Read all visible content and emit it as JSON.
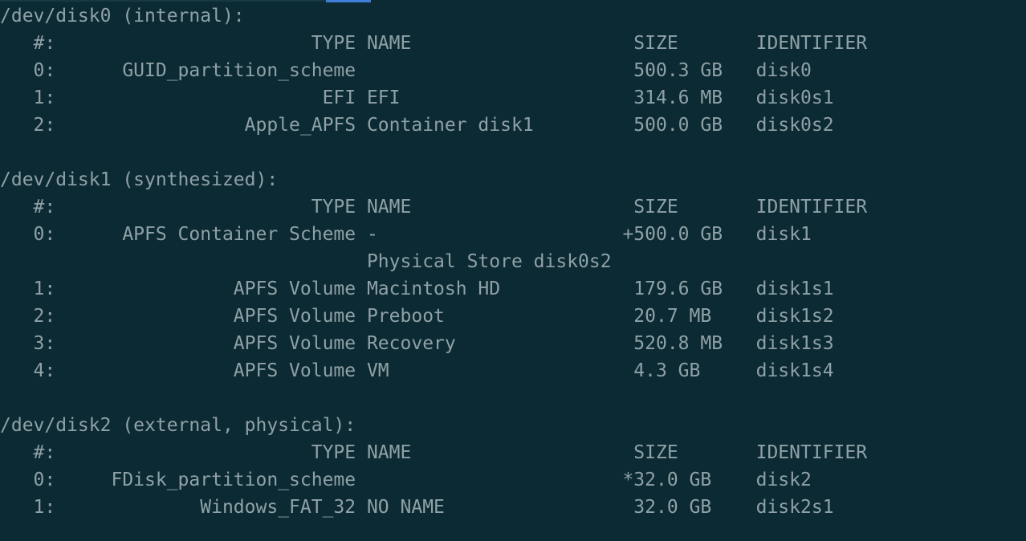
{
  "terminal": {
    "lines": [
      "/dev/disk0 (internal):",
      "   #:                       TYPE NAME                    SIZE       IDENTIFIER",
      "   0:      GUID_partition_scheme                         500.3 GB   disk0",
      "   1:                        EFI EFI                     314.6 MB   disk0s1",
      "   2:                 Apple_APFS Container disk1         500.0 GB   disk0s2",
      "",
      "/dev/disk1 (synthesized):",
      "   #:                       TYPE NAME                    SIZE       IDENTIFIER",
      "   0:      APFS Container Scheme -                      +500.0 GB   disk1",
      "                                 Physical Store disk0s2",
      "   1:                APFS Volume Macintosh HD            179.6 GB   disk1s1",
      "   2:                APFS Volume Preboot                 20.7 MB    disk1s2",
      "   3:                APFS Volume Recovery                520.8 MB   disk1s3",
      "   4:                APFS Volume VM                      4.3 GB     disk1s4",
      "",
      "/dev/disk2 (external, physical):",
      "   #:                       TYPE NAME                    SIZE       IDENTIFIER",
      "   0:     FDisk_partition_scheme                        *32.0 GB    disk2",
      "   1:             Windows_FAT_32 NO NAME                 32.0 GB    disk2s1"
    ]
  }
}
